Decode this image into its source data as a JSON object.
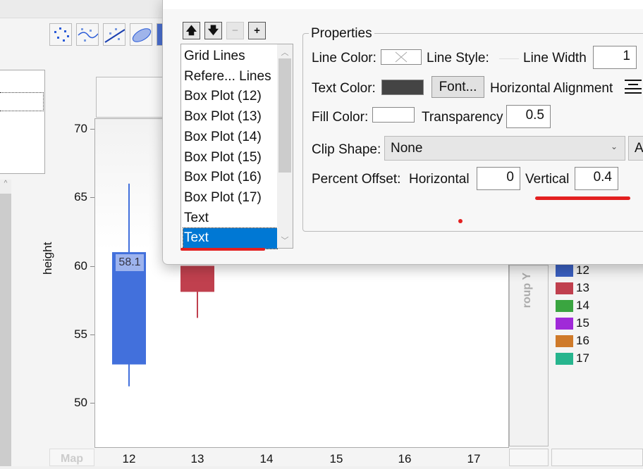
{
  "toolbar": {
    "icons": [
      "points-icon",
      "smoother-icon",
      "line-of-fit-icon",
      "ellipse-icon"
    ]
  },
  "dialog": {
    "order_buttons": {
      "up": "🡅",
      "down": "🡇",
      "remove": "−",
      "add": "+"
    },
    "list_items": [
      "Grid Lines",
      "Refere... Lines",
      "Box Plot (12)",
      "Box Plot (13)",
      "Box Plot (14)",
      "Box Plot (15)",
      "Box Plot (16)",
      "Box Plot (17)",
      "Text",
      "Text"
    ],
    "selected_index": 9,
    "properties": {
      "title": "Properties",
      "line_color_label": "Line Color:",
      "line_style_label": "Line Style:",
      "line_width_label": "Line Width",
      "line_width_value": "1",
      "text_color_label": "Text Color:",
      "text_color": "#444444",
      "font_button": "Font...",
      "horizontal_alignment_label": "Horizontal Alignment",
      "fill_color_label": "Fill Color:",
      "fill_color": "#ffffff",
      "transparency_label": "Transparency",
      "transparency_value": "0.5",
      "clip_shape_label": "Clip Shape:",
      "clip_shape_value": "None",
      "side_button": "A",
      "percent_offset_label": "Percent Offset:",
      "horizontal_label": "Horizontal",
      "horizontal_value": "0",
      "vertical_label": "Vertical",
      "vertical_value": "0.4"
    }
  },
  "graph": {
    "y_label": "height",
    "y_ticks": [
      "70",
      "65",
      "60",
      "55",
      "50"
    ],
    "x_ticks": [
      "12",
      "13",
      "14",
      "15",
      "16",
      "17"
    ],
    "box_label": "58.1",
    "group_label": "roup Y",
    "map_label": "Map",
    "legend": [
      {
        "label": "12",
        "color": "#3a5fbf"
      },
      {
        "label": "13",
        "color": "#c0404e"
      },
      {
        "label": "14",
        "color": "#3aa540"
      },
      {
        "label": "15",
        "color": "#a02ad8"
      },
      {
        "label": "16",
        "color": "#cf7a2a"
      },
      {
        "label": "17",
        "color": "#27b58e"
      }
    ]
  },
  "chart_data": {
    "type": "box",
    "categories": [
      "12",
      "13",
      "14",
      "15",
      "16",
      "17"
    ],
    "ylabel": "height",
    "ylim": [
      47.5,
      71
    ],
    "boxes": [
      {
        "category": "12",
        "whisker_high": 66,
        "q3": 61,
        "q1": 52.8,
        "whisker_low": 51.2,
        "label": "58.1",
        "color": "#4270dc"
      },
      {
        "category": "13",
        "q3": 60,
        "q1": 58.1,
        "whisker_low": 56.2,
        "color": "#c0404e"
      }
    ]
  }
}
